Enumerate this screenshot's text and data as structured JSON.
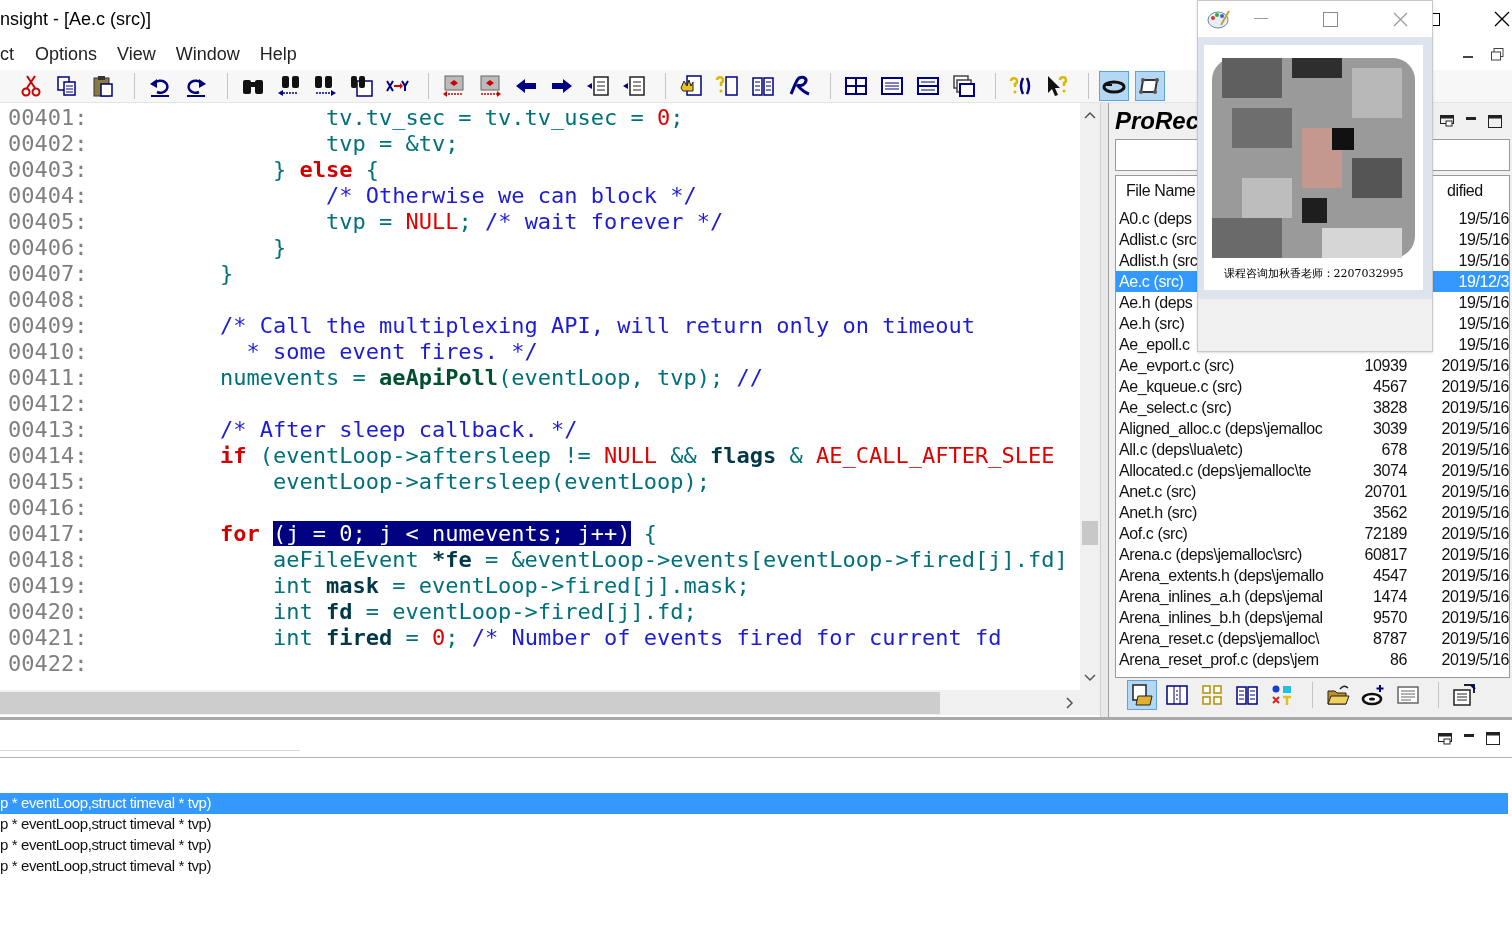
{
  "window": {
    "title": "nsight - [Ae.c (src)]"
  },
  "menu": [
    {
      "label": "ct"
    },
    {
      "label": "Options"
    },
    {
      "label": "View"
    },
    {
      "label": "Window"
    },
    {
      "label": "Help"
    }
  ],
  "toolbar": [
    {
      "kind": "cut"
    },
    {
      "kind": "copy"
    },
    {
      "kind": "paste"
    },
    {
      "kind": "separator"
    },
    {
      "kind": "undo"
    },
    {
      "kind": "redo"
    },
    {
      "kind": "separator"
    },
    {
      "kind": "find"
    },
    {
      "kind": "findprev"
    },
    {
      "kind": "findnext"
    },
    {
      "kind": "findfiles"
    },
    {
      "kind": "replace"
    },
    {
      "kind": "separator"
    },
    {
      "kind": "bookmarkleft"
    },
    {
      "kind": "bookmarkright"
    },
    {
      "kind": "back"
    },
    {
      "kind": "forward"
    },
    {
      "kind": "jumplist"
    },
    {
      "kind": "jumplist"
    },
    {
      "kind": "separator"
    },
    {
      "kind": "hand"
    },
    {
      "kind": "helpdoc"
    },
    {
      "kind": "book"
    },
    {
      "kind": "script"
    },
    {
      "kind": "separator"
    },
    {
      "kind": "tile"
    },
    {
      "kind": "window"
    },
    {
      "kind": "split"
    },
    {
      "kind": "cascade"
    },
    {
      "kind": "separator"
    },
    {
      "kind": "helpparen"
    },
    {
      "kind": "pointerhelp"
    },
    {
      "kind": "separator"
    },
    {
      "kind": "ring",
      "pressed": true
    },
    {
      "kind": "frame",
      "pressed": true
    }
  ],
  "editor": {
    "lines": [
      {
        "number": "00401:",
        "tokens": [
          {
            "text": "                tv.tv_sec = tv.tv_usec = ",
            "kind": "ident"
          },
          {
            "text": "0",
            "kind": "number"
          },
          {
            "text": ";",
            "kind": "ident"
          }
        ]
      },
      {
        "number": "00402:",
        "tokens": [
          {
            "text": "                tvp = &tv;",
            "kind": "ident"
          }
        ]
      },
      {
        "number": "00403:",
        "tokens": [
          {
            "text": "            } ",
            "kind": "ident"
          },
          {
            "text": "else",
            "kind": "keyword"
          },
          {
            "text": " {",
            "kind": "ident"
          }
        ]
      },
      {
        "number": "00404:",
        "tokens": [
          {
            "text": "                /* Otherwise we can block */",
            "kind": "comment"
          }
        ]
      },
      {
        "number": "00405:",
        "tokens": [
          {
            "text": "                tvp = ",
            "kind": "ident"
          },
          {
            "text": "NULL",
            "kind": "number"
          },
          {
            "text": "; ",
            "kind": "ident"
          },
          {
            "text": "/* wait forever */",
            "kind": "comment"
          }
        ]
      },
      {
        "number": "00406:",
        "tokens": [
          {
            "text": "            }",
            "kind": "ident"
          }
        ]
      },
      {
        "number": "00407:",
        "tokens": [
          {
            "text": "        }",
            "kind": "ident"
          }
        ]
      },
      {
        "number": "00408:"
      },
      {
        "number": "00409:",
        "tokens": [
          {
            "text": "        /* Call the multiplexing API, will return only on timeout",
            "kind": "comment"
          }
        ]
      },
      {
        "number": "00410:",
        "tokens": [
          {
            "text": "          * some event fires. */",
            "kind": "comment"
          }
        ]
      },
      {
        "number": "00411:",
        "tokens": [
          {
            "text": "        numevents = ",
            "kind": "ident"
          },
          {
            "text": "aeApiPoll",
            "kind": "func"
          },
          {
            "text": "(eventLoop, tvp); ",
            "kind": "ident"
          },
          {
            "text": "//",
            "kind": "comment"
          }
        ]
      },
      {
        "number": "00412:"
      },
      {
        "number": "00413:",
        "tokens": [
          {
            "text": "        /* After sleep callback. */",
            "kind": "comment"
          }
        ]
      },
      {
        "number": "00414:",
        "tokens": [
          {
            "text": "        if",
            "kind": "keyword"
          },
          {
            "text": " (eventLoop->aftersleep != ",
            "kind": "ident"
          },
          {
            "text": "NULL",
            "kind": "number"
          },
          {
            "text": " && ",
            "kind": "ident"
          },
          {
            "text": "flags",
            "kind": "bold"
          },
          {
            "text": " & ",
            "kind": "ident"
          },
          {
            "text": "AE_CALL_AFTER_SLEE",
            "kind": "number"
          }
        ]
      },
      {
        "number": "00415:",
        "tokens": [
          {
            "text": "            eventLoop->aftersleep(eventLoop);",
            "kind": "ident"
          }
        ]
      },
      {
        "number": "00416:"
      },
      {
        "number": "00417:",
        "tokens": [
          {
            "text": "        for ",
            "kind": "keyword"
          },
          {
            "text": "(j = 0; j < numevents; j++)",
            "kind": "selected"
          },
          {
            "text": " {",
            "kind": "ident"
          }
        ]
      },
      {
        "number": "00418:",
        "tokens": [
          {
            "text": "            aeFileEvent ",
            "kind": "ident"
          },
          {
            "text": "*fe",
            "kind": "bold"
          },
          {
            "text": " = &eventLoop->events[eventLoop->fired[j].fd]",
            "kind": "ident"
          }
        ]
      },
      {
        "number": "00419:",
        "tokens": [
          {
            "text": "            int ",
            "kind": "ident"
          },
          {
            "text": "mask",
            "kind": "bold"
          },
          {
            "text": " = eventLoop->fired[j].mask;",
            "kind": "ident"
          }
        ]
      },
      {
        "number": "00420:",
        "tokens": [
          {
            "text": "            int ",
            "kind": "ident"
          },
          {
            "text": "fd",
            "kind": "bold"
          },
          {
            "text": " = eventLoop->fired[j].fd;",
            "kind": "ident"
          }
        ]
      },
      {
        "number": "00421:",
        "tokens": [
          {
            "text": "            int ",
            "kind": "ident"
          },
          {
            "text": "fired",
            "kind": "bold"
          },
          {
            "text": " = ",
            "kind": "ident"
          },
          {
            "text": "0",
            "kind": "number"
          },
          {
            "text": "; ",
            "kind": "ident"
          },
          {
            "text": "/* Number of events fired for current fd",
            "kind": "comment"
          }
        ]
      },
      {
        "number": "00422:"
      }
    ]
  },
  "project_panel": {
    "title": "ProRec",
    "columns": [
      {
        "label": "File Name"
      },
      {
        "label": "dified"
      }
    ],
    "rows": [
      {
        "name": "A0.c (deps",
        "date": "19/5/16",
        "selected": false
      },
      {
        "name": "Adlist.c (src",
        "date": "19/5/16",
        "selected": false
      },
      {
        "name": "Adlist.h (src",
        "date": "19/5/16",
        "selected": false
      },
      {
        "name": "Ae.c (src)",
        "date": "19/12/3",
        "selected": true
      },
      {
        "name": "Ae.h (deps",
        "date": "19/5/16",
        "selected": false
      },
      {
        "name": "Ae.h (src)",
        "date": "19/5/16",
        "selected": false
      },
      {
        "name": "Ae_epoll.c",
        "date": "19/5/16",
        "selected": false
      },
      {
        "name": "Ae_evport.c (src)",
        "size": "10939",
        "date": "2019/5/16",
        "selected": false
      },
      {
        "name": "Ae_kqueue.c (src)",
        "size": "4567",
        "date": "2019/5/16",
        "selected": false
      },
      {
        "name": "Ae_select.c (src)",
        "size": "3828",
        "date": "2019/5/16",
        "selected": false
      },
      {
        "name": "Aligned_alloc.c (deps\\jemalloc",
        "size": "3039",
        "date": "2019/5/16",
        "selected": false
      },
      {
        "name": "All.c (deps\\lua\\etc)",
        "size": "678",
        "date": "2019/5/16",
        "selected": false
      },
      {
        "name": "Allocated.c (deps\\jemalloc\\te",
        "size": "3074",
        "date": "2019/5/16",
        "selected": false
      },
      {
        "name": "Anet.c (src)",
        "size": "20701",
        "date": "2019/5/16",
        "selected": false
      },
      {
        "name": "Anet.h (src)",
        "size": "3562",
        "date": "2019/5/16",
        "selected": false
      },
      {
        "name": "Aof.c (src)",
        "size": "72189",
        "date": "2019/5/16",
        "selected": false
      },
      {
        "name": "Arena.c (deps\\jemalloc\\src)",
        "size": "60817",
        "date": "2019/5/16",
        "selected": false
      },
      {
        "name": "Arena_extents.h (deps\\jemallo",
        "size": "4547",
        "date": "2019/5/16",
        "selected": false
      },
      {
        "name": "Arena_inlines_a.h (deps\\jemal",
        "size": "1474",
        "date": "2019/5/16",
        "selected": false
      },
      {
        "name": "Arena_inlines_b.h (deps\\jemal",
        "size": "9570",
        "date": "2019/5/16",
        "selected": false
      },
      {
        "name": "Arena_reset.c (deps\\jemalloc\\",
        "size": "8787",
        "date": "2019/5/16",
        "selected": false
      },
      {
        "name": "Arena_reset_prof.c (deps\\jem",
        "size": "86",
        "date": "2019/5/16",
        "selected": false
      }
    ],
    "toolbar": [
      {
        "kind": "docfolder",
        "pressed": true
      },
      {
        "kind": "columns"
      },
      {
        "kind": "squares"
      },
      {
        "kind": "book"
      },
      {
        "kind": "shapes"
      },
      {
        "kind": "separator"
      },
      {
        "kind": "openfolder"
      },
      {
        "kind": "diskplus"
      },
      {
        "kind": "listdoc"
      },
      {
        "kind": "separator"
      },
      {
        "kind": "properties"
      }
    ]
  },
  "bottom_panel": {
    "rows": [
      {
        "text": "p * eventLoop,struct timeval * tvp)",
        "selected": true
      },
      {
        "text": "p * eventLoop,struct timeval * tvp)",
        "selected": false
      },
      {
        "text": "p * eventLoop,struct timeval * tvp)",
        "selected": false
      },
      {
        "text": "p * eventLoop,struct timeval * tvp)",
        "selected": false
      }
    ]
  },
  "popup": {
    "caption": "课程咨询加秋香老师：2207032995"
  }
}
